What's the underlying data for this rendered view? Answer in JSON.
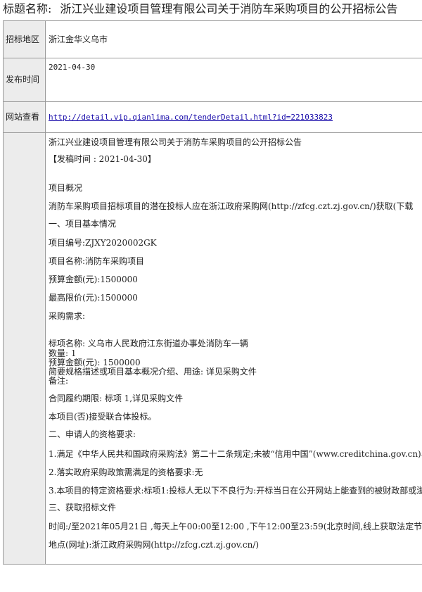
{
  "header": {
    "label": "标题名称:",
    "title": "浙江兴业建设项目管理有限公司关于消防车采购项目的公开招标公告"
  },
  "info": {
    "region_label": "招标地区",
    "region_value": "浙江金华义乌市",
    "publish_label": "发布时间",
    "publish_value": "2021-04-30",
    "url_label": "网站查看",
    "url_value": "http://detail.vip.qianlima.com/tenderDetail.html?id=221033823"
  },
  "content": {
    "lines": [
      "浙江兴业建设项目管理有限公司关于消防车采购项目的公开招标公告",
      "【发稿时间 : 2021-04-30】",
      "项目概况",
      "消防车采购项目招标项目的潜在投标人应在浙江政府采购网(http://zfcg.czt.zj.gov.cn/)获取(下载",
      "一、项目基本情况",
      "项目编号:ZJXY2020002GK",
      "项目名称:消防车采购项目",
      "预算金额(元):1500000",
      "最高限价(元):1500000",
      "采购需求:",
      "标项名称: 义乌市人民政府江东街道办事处消防车一辆",
      "数量: 1",
      "预算金额(元): 1500000",
      "简要规格描述或项目基本概况介绍、用途: 详见采购文件",
      "备注:",
      "合同履约期限: 标项 1,详见采购文件",
      "本项目(否)接受联合体投标。",
      "二、申请人的资格要求:",
      "1.满足《中华人民共和国政府采购法》第二十二条规定;未被“信用中国”(www.creditchina.gov.cn)、",
      "2.落实政府采购政策需满足的资格要求:无",
      "3.本项目的特定资格要求:标项1:投标人无以下不良行为:开标当日在公开网站上能查到的被财政部或浙江",
      "三、获取招标文件",
      "时间:/至2021年05月21日 ,每天上午00:00至12:00 ,下午12:00至23:59(北京时间,线上获取法定节假",
      "地点(网址):浙江政府采购网(http://zfcg.czt.zj.gov.cn/)"
    ]
  }
}
